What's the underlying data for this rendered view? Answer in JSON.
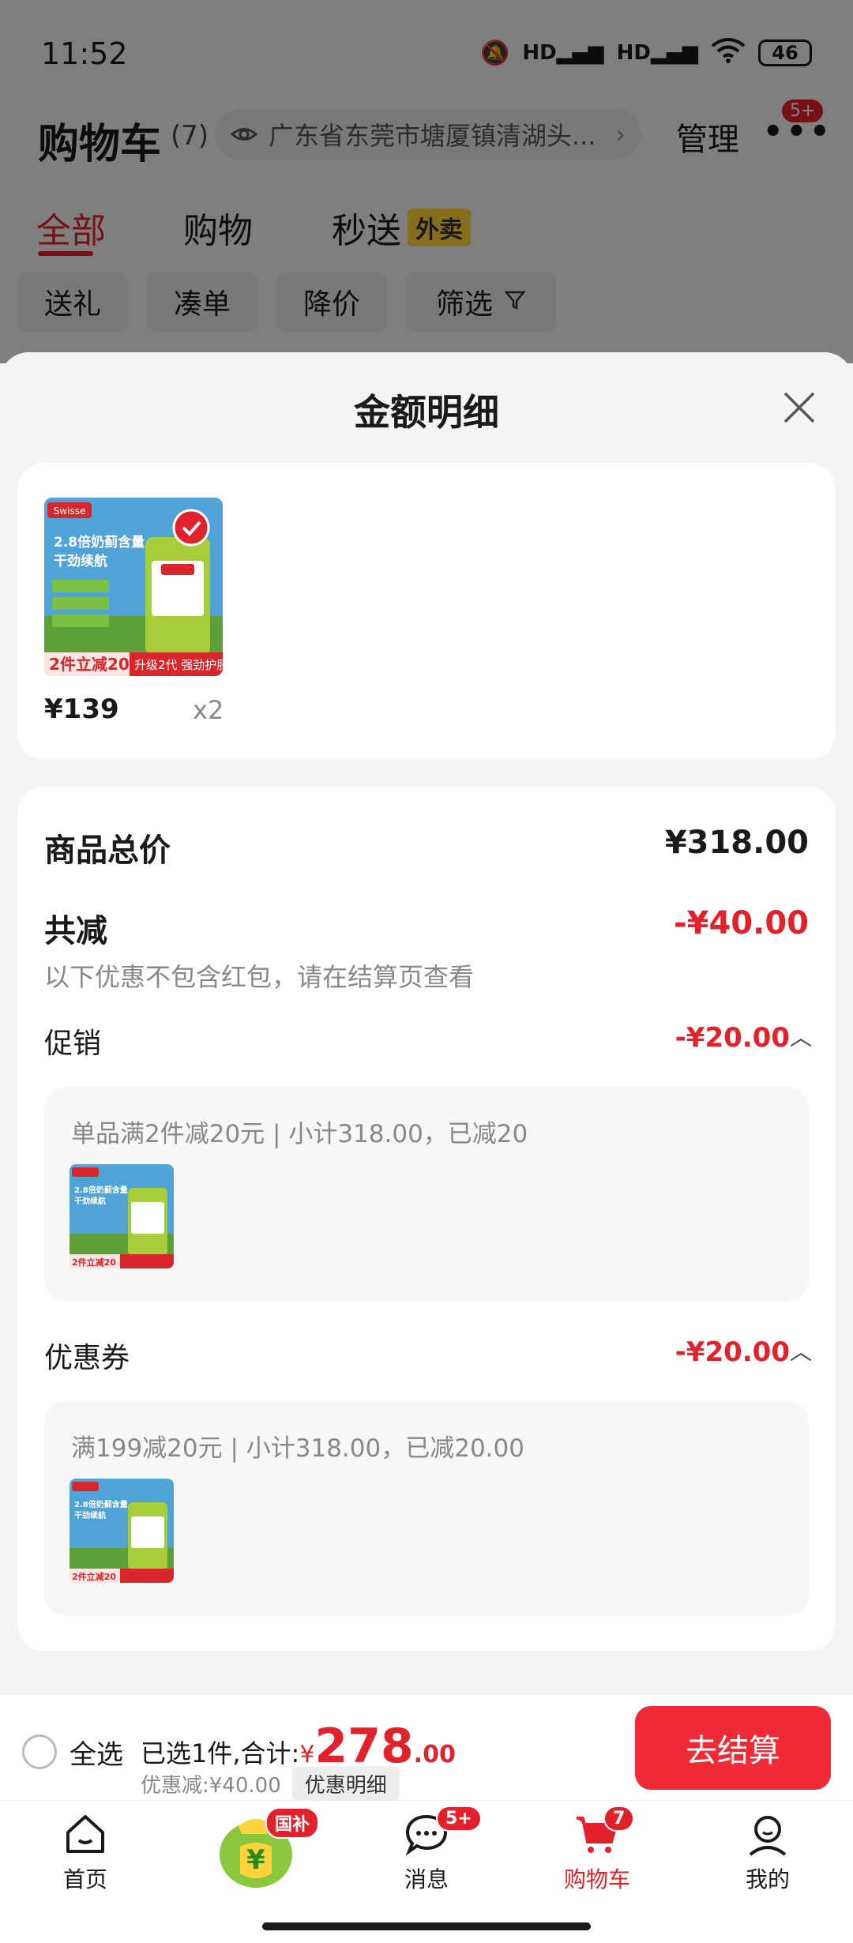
{
  "status_bar": {
    "time": "11:52",
    "battery": "46"
  },
  "header": {
    "title": "购物车",
    "count": "(7)",
    "address": "广东省东莞市塘厦镇清湖头...",
    "manage": "管理",
    "more_badge": "5+"
  },
  "top_tabs": [
    {
      "label": "全部"
    },
    {
      "label": "购物"
    },
    {
      "label": "秒送"
    }
  ],
  "waimai_tag": "外卖",
  "filters": [
    "送礼",
    "凑单",
    "降价",
    "筛选"
  ],
  "sheet": {
    "title": "金额明细",
    "product": {
      "price": "¥139",
      "qty": "x2"
    },
    "total_label": "商品总价",
    "total_value": "¥318.00",
    "reduce_label": "共减",
    "reduce_value": "-¥40.00",
    "reduce_note": "以下优惠不包含红包，请在结算页查看",
    "promo": {
      "label": "促销",
      "value": "-¥20.00",
      "detail": "单品满2件减20元 | 小计318.00，已减20"
    },
    "coupon": {
      "label": "优惠券",
      "value": "-¥20.00",
      "detail": "满199减20元 | 小计318.00，已减20.00"
    }
  },
  "checkout": {
    "select_all": "全选",
    "selected_prefix": "已选1件,合计:",
    "currency": "¥",
    "total_int": "278",
    "total_dec": ".00",
    "discount": "优惠减:¥40.00",
    "detail_chip": "优惠明细",
    "button": "去结算"
  },
  "tabbar": {
    "items": [
      {
        "label": "首页"
      },
      {
        "label": ""
      },
      {
        "label": "消息"
      },
      {
        "label": "购物车"
      },
      {
        "label": "我的"
      }
    ],
    "guobu_badge": "国补",
    "msg_badge": "5+",
    "cart_badge": "7"
  },
  "colors": {
    "accent": "#e3212b",
    "button": "#f02b35"
  }
}
